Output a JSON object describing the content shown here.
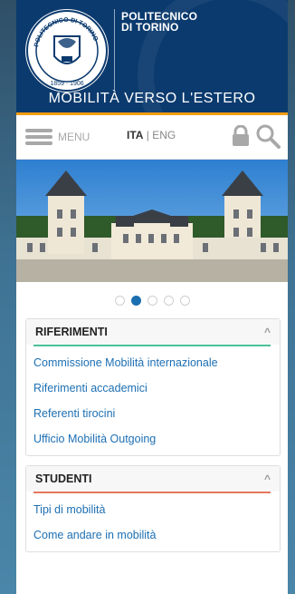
{
  "brand": {
    "line1": "POLITECNICO",
    "line2": "DI TORINO",
    "seal_text_top": "POLITECNICO DI TORINO",
    "seal_years": "1859 · 1906",
    "site_title": "MOBILITÀ VERSO L'ESTERO"
  },
  "nav": {
    "menu_label": "MENU",
    "lang_ita": "ITA",
    "lang_sep": " | ",
    "lang_eng": "ENG",
    "icons": [
      "menu-icon",
      "lock-icon",
      "search-icon"
    ]
  },
  "carousel": {
    "slides": 5,
    "active": 2
  },
  "sections": [
    {
      "title": "RIFERIMENTI",
      "accent": "#4ac29b",
      "links": [
        "Commissione Mobilità internazionale",
        "Riferimenti accademici",
        "Referenti tirocini",
        "Ufficio Mobilità Outgoing"
      ]
    },
    {
      "title": "STUDENTI",
      "accent": "#e7775f",
      "links": [
        "Tipi di mobilità",
        "Come andare in mobilità"
      ]
    }
  ],
  "colors": {
    "header": "#0b3a6e",
    "accent_orange": "#f39c12",
    "link": "#1d6fb3"
  }
}
